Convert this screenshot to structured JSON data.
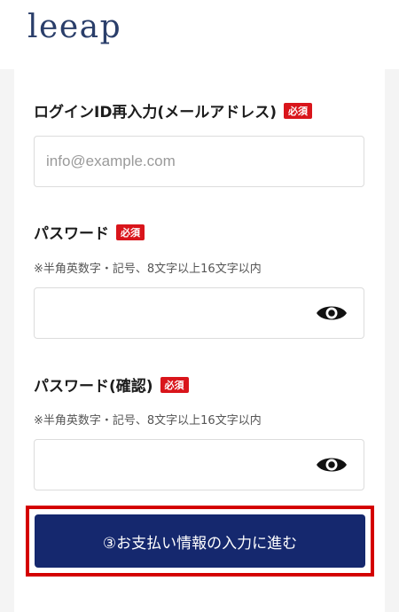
{
  "header": {
    "logo": "leeap"
  },
  "form": {
    "email_confirm": {
      "label": "ログインID再入力(メールアドレス)",
      "badge": "必須",
      "placeholder": "info@example.com"
    },
    "password": {
      "label": "パスワード",
      "badge": "必須",
      "hint": "※半角英数字・記号、8文字以上16文字以内"
    },
    "password_confirm": {
      "label": "パスワード(確認)",
      "badge": "必須",
      "hint": "※半角英数字・記号、8文字以上16文字以内"
    },
    "submit_label": "③お支払い情報の入力に進む"
  },
  "colors": {
    "accent": "#15286e",
    "required": "#d9151b",
    "highlight": "#d40000",
    "logo": "#2a3e6a"
  },
  "icons": {
    "visibility": "eye-icon"
  }
}
